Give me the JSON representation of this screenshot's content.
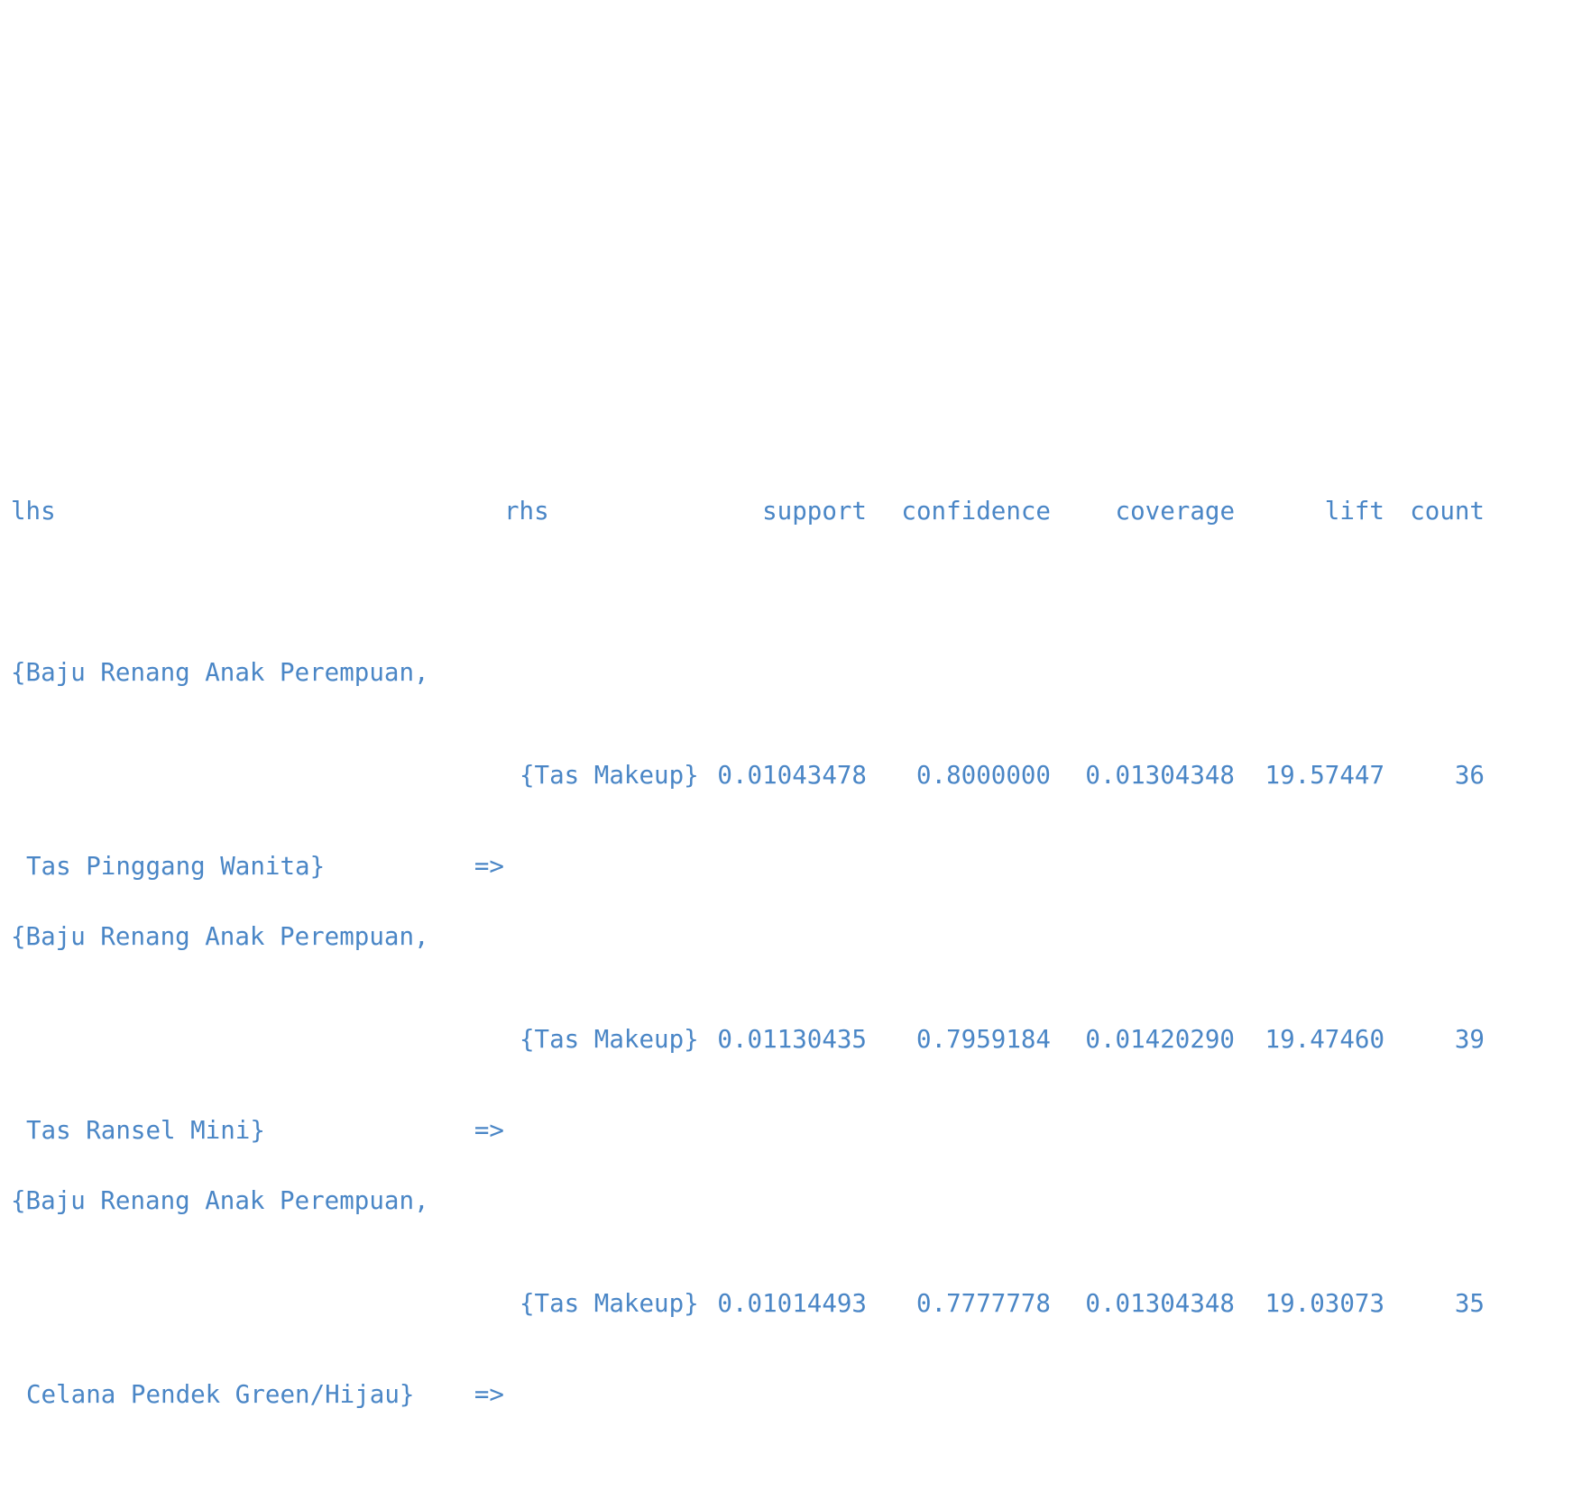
{
  "header": {
    "lhs": "lhs",
    "rhs": "rhs",
    "support": "support",
    "confidence": "confidence",
    "coverage": "coverage",
    "lift": "lift",
    "count": "count"
  },
  "rules": [
    {
      "lhs_line1": "{Baju Renang Anak Perempuan,",
      "lhs_line2": "Tas Pinggang Wanita}",
      "arrow": "=>",
      "rhs": "{Tas Makeup}",
      "support": "0.01043478",
      "confidence": "0.8000000",
      "coverage": "0.01304348",
      "lift": "19.57447",
      "count": "36"
    },
    {
      "lhs_line1": "{Baju Renang Anak Perempuan,",
      "lhs_line2": "Tas Ransel Mini}",
      "arrow": "=>",
      "rhs": "{Tas Makeup}",
      "support": "0.01130435",
      "confidence": "0.7959184",
      "coverage": "0.01420290",
      "lift": "19.47460",
      "count": "39"
    },
    {
      "lhs_line1": "{Baju Renang Anak Perempuan,",
      "lhs_line2": "Celana Pendek Green/Hijau}",
      "arrow": "=>",
      "rhs": "{Tas Makeup}",
      "support": "0.01014493",
      "confidence": "0.7777778",
      "coverage": "0.01304348",
      "lift": "19.03073",
      "count": "35"
    }
  ]
}
